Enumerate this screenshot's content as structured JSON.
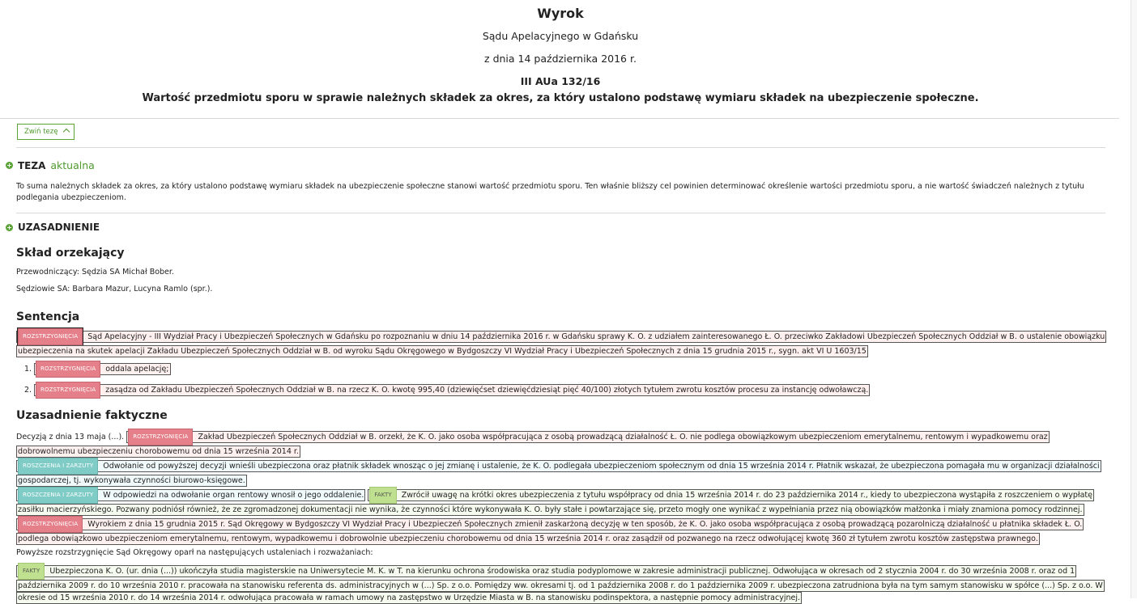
{
  "header": {
    "title": "Wyrok",
    "court": "Sądu Apelacyjnego w Gdańsku",
    "date": "z dnia 14 października 2016 r.",
    "signature": "III AUa 132/16",
    "subject": "Wartość przedmiotu sporu w sprawie należnych składek za okres, za który ustalono podstawę wymiaru składek na ubezpieczenie społeczne."
  },
  "toggle": {
    "label": "Zwiń tezę"
  },
  "teza": {
    "heading": "TEZA",
    "status": "aktualna",
    "text": "To suma należnych składek za okres, za który ustalono podstawę wymiaru składek na ubezpieczenie społeczne stanowi wartość przedmiotu sporu. Ten właśnie bliższy cel powinien determinować określenie wartości przedmiotu sporu, a nie wartość świadczeń należnych z tytułu podlegania ubezpieczeniom."
  },
  "uzasadnienie": {
    "heading": "UZASADNIENIE"
  },
  "sklad": {
    "heading": "Skład orzekający",
    "chair": "Przewodniczący: Sędzia SA Michał Bober.",
    "judges": "Sędziowie SA: Barbara Mazur, Lucyna Ramlo (spr.)."
  },
  "tags": {
    "r": "ROZSTRZYGNIĘCIA",
    "c": "ROSZCZENIA I ZARZUTY",
    "f": "FAKTY"
  },
  "sentencja": {
    "heading": "Sentencja",
    "intro": "Sąd Apelacyjny - III Wydział Pracy i Ubezpieczeń Społecznych w Gdańsku po rozpoznaniu w dniu 14 października 2016 r. w Gdańsku sprawy K. O. z udziałem zainteresowanego Ł. O. przeciwko Zakładowi Ubezpieczeń Społecznych Oddział w B. o ustalenie obowiązku ubezpieczenia na skutek apelacji Zakładu Ubezpieczeń Społecznych Oddział w B. od wyroku Sądu Okręgowego w Bydgoszczy VI Wydział Pracy i Ubezpieczeń Społecznych z dnia 15 grudnia 2015 r., sygn. akt VI U 1603/15",
    "items": [
      {
        "num": "1.",
        "text": "oddala apelację;"
      },
      {
        "num": "2.",
        "text": "zasądza od Zakładu Ubezpieczeń Społecznych Oddział w B. na rzecz K. O. kwotę 995,40 (dziewięćset dziewięćdziesiąt pięć 40/100) złotych tytułem zwrotu kosztów procesu za instancję odwoławczą."
      }
    ]
  },
  "faktyczne": {
    "heading": "Uzasadnienie faktyczne",
    "p1_pre": "Decyzją z dnia 13 maja (...).",
    "p1": "Zakład Ubezpieczeń Społecznych Oddział w B. orzekł, że K. O. jako osoba współpracująca z osobą prowadzącą działalność Ł. O. nie podlega obowiązkowym ubezpieczeniom emerytalnemu, rentowym i wypadkowemu oraz dobrowolnemu ubezpieczeniu chorobowemu od dnia 15 września 2014 r.",
    "p2": "Odwołanie od powyższej decyzji wnieśli ubezpieczona oraz płatnik składek wnosząc o jej zmianę i ustalenie, że K. O. podlegała ubezpieczeniom społecznym od dnia 15 września 2014 r. Płatnik wskazał, że ubezpieczona pomagała mu w organizacji działalności gospodarczej, tj. wykonywała czynności biurowo-księgowe.",
    "p3a": "W odpowiedzi na odwołanie organ rentowy wnosił o jego oddalenie.",
    "p3b": "Zwrócił uwagę na krótki okres ubezpieczenia z tytułu współpracy od dnia 15 września 2014 r. do 23 października 2014 r., kiedy to ubezpieczona wystąpiła z roszczeniem o wypłatę zasiłku macierzyńskiego. Pozwany podniósł również, że ze zgromadzonej dokumentacji nie wynika, że czynności które wykonywała K. O. były stałe i powtarzające się, przeto mogły one wynikać z wypełniania przez nią obowiązków małżonka i miały znamiona pomocy rodzinnej.",
    "p4": "Wyrokiem z dnia 15 grudnia 2015 r. Sąd Okręgowy w Bydgoszczy VI Wydział Pracy i Ubezpieczeń Społecznych zmienił zaskarżoną decyzję w ten sposób, że K. O. jako osoba współpracująca z osobą prowadzącą pozarolniczą działalność u płatnika składek Ł. O. podlega obowiązkowo ubezpieczeniom emerytalnemu, rentowym, wypadkowemu i dobrowolnie ubezpieczeniu chorobowemu od dnia 15 września 2014 r. oraz zasądził od pozwanego na rzecz odwołującej kwotę 360 zł tytułem zwrotu kosztów zastępstwa prawnego.",
    "p5": "Powyższe rozstrzygnięcie Sąd Okręgowy oparł na następujących ustaleniach i rozważaniach:",
    "p6": "Ubezpieczona K. O. (ur. dnia (...)) ukończyła studia magisterskie na Uniwersytecie M. K. w T. na kierunku ochrona środowiska oraz studia podyplomowe w zakresie administracji publicznej. Odwołująca w okresach od 2 stycznia 2004 r. do 30 września 2008 r. oraz od 1 października 2009 r. do 10 września 2010 r. pracowała na stanowisku referenta ds. administracyjnych w (...) Sp. z o.o. Pomiędzy ww. okresami tj. od 1 października 2008 r. do 1 października 2009 r. ubezpieczona zatrudniona była na tym samym stanowisku w spółce (...) Sp. z o.o. W okresie od 15 września 2010 r. do 14 września 2014 r. odwołująca pracowała w ramach umowy na zastępstwo w Urzędzie Miasta w B. na stanowisku podinspektora, a następnie pomocy administracyjnej."
  }
}
